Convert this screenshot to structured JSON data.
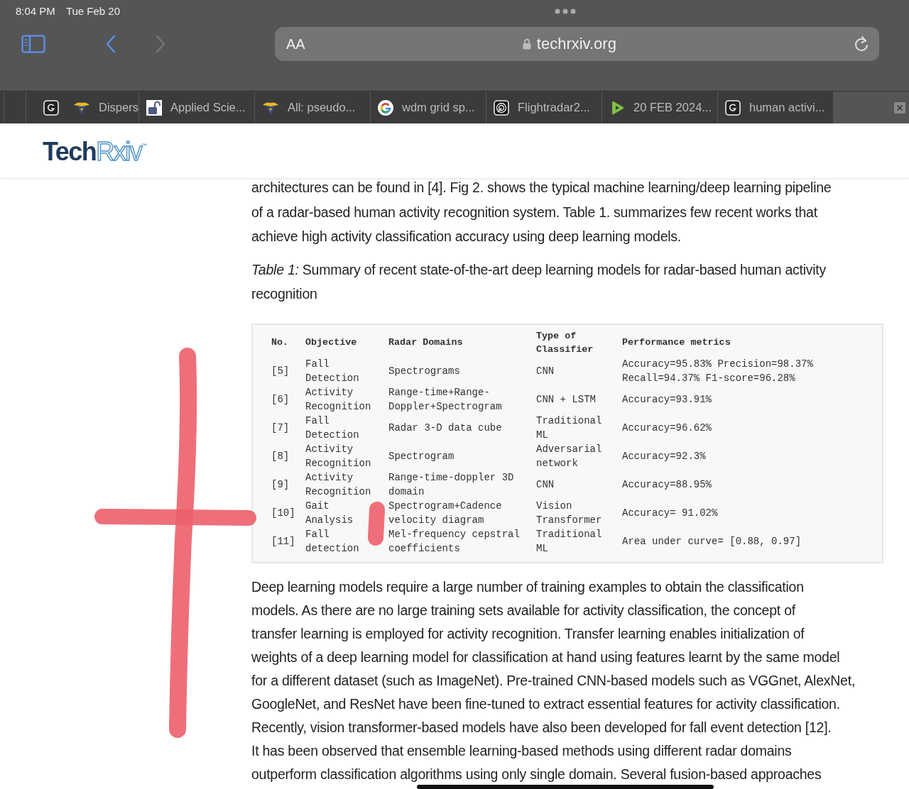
{
  "status_bar": {
    "time": "8:04 PM",
    "date": "Tue Feb 20"
  },
  "toolbar": {
    "forward_disabled": true,
    "address": {
      "text_size_button": "AA",
      "url": "techrxiv.org"
    }
  },
  "tabs": [
    {
      "kind": "g"
    },
    {
      "kind": "eagle",
      "title": "Dispers"
    },
    {
      "kind": "lock",
      "title": "Applied Scie..."
    },
    {
      "kind": "eagle",
      "title": "All: pseudo..."
    },
    {
      "kind": "google",
      "title": "wdm grid sp..."
    },
    {
      "kind": "radar",
      "title": "Flightradar2..."
    },
    {
      "kind": "play",
      "title": "20 FEB 2024..."
    },
    {
      "kind": "g",
      "title": "human activi..."
    }
  ],
  "site_header": {
    "logo": {
      "part_1": "Tech",
      "part_2": "Rxiv",
      "mark": "™"
    }
  },
  "article": {
    "intro_lines": [
      "architectures can be found in [4]. Fig 2. shows the typical machine learning/deep learning pipeline",
      "of a radar-based human activity recognition system. Table 1. summarizes few recent works that",
      "achieve high activity classification accuracy using deep learning models."
    ],
    "caption": "*Table 1:* Summary of recent state-of-the-art deep learning models for radar-based human activity recognition",
    "table": {
      "columns": [
        "No.",
        "Objective",
        "Radar Domains",
        "Type of Classifier",
        "Performance metrics"
      ],
      "rows": [
        [
          "[5]",
          "Fall Detection",
          "Spectrograms",
          "CNN",
          "Accuracy=95.83% Precision=98.37% Recall=94.37% F1-score=96.28%"
        ],
        [
          "[6]",
          "Activity Recognition",
          "Range-time+Range-Doppler+Spectrogram",
          "CNN + LSTM",
          "Accuracy=93.91%"
        ],
        [
          "[7]",
          "Fall Detection",
          "Radar 3-D data cube",
          "Traditional ML",
          "Accuracy=96.62%"
        ],
        [
          "[8]",
          "Activity Recognition",
          "Spectrogram",
          "Adversarial network",
          "Accuracy=92.3%"
        ],
        [
          "[9]",
          "Activity Recognition",
          "Range-time-doppler 3D domain",
          "CNN",
          "Accuracy=88.95%"
        ],
        [
          "[10]",
          "Gait Analysis",
          "Spectrogram+Cadence velocity diagram",
          "Vision Transformer",
          "Accuracy= 91.02%"
        ],
        [
          "[11]",
          "Fall detection",
          "Mel-frequency cepstral coefficients",
          "Traditional ML",
          "Area under curve= [0.88, 0.97]"
        ]
      ]
    },
    "body_lines": [
      "Deep learning models require a large number of training examples to obtain the classification",
      "models. As there are no large training sets available for activity classification, the concept of",
      "transfer learning is employed for activity recognition. Transfer learning enables initialization of",
      "weights of a deep learning model for classification at hand using features learnt by the same model",
      "for a different dataset (such as ImageNet). Pre-trained CNN-based models such as VGGnet, AlexNet,",
      "GoogleNet, and ResNet have been fine-tuned to extract essential features for activity classification.",
      "Recently, vision transformer-based models have also been developed for fall event detection [12].",
      "It has been observed that ensemble learning-based methods using different radar domains",
      "outperform classification algorithms using only single domain. Several fusion-based approaches"
    ]
  }
}
